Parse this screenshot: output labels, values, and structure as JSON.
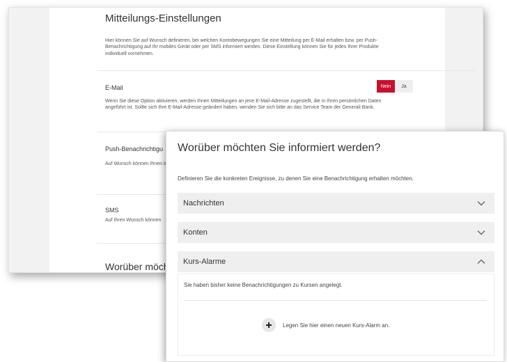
{
  "back": {
    "title": "Mitteilungs-Einstellungen",
    "intro": "Hier können Sie auf Wunsch definieren, bei welchen Kontobewegungen Sie eine Mitteilung per E-Mail erhalten bzw. per Push-Benachrichtigung auf Ihr mobiles Gerät oder per SMS informiert werden. Diese Einstellung können Sie für jedes Ihrer Produkte individuell vornehmen.",
    "email_label": "E-Mail",
    "toggle_no": "Nein",
    "toggle_yes": "Ja",
    "email_desc": "Wenn Sie diese Option aktivieren, werden Ihnen Mitteilungen an jene E-Mail-Adresse zugestellt, die in Ihren persönlichen Daten angeführt ist. Sollte sich Ihre E-Mail-Adresse geändert haben, wenden Sie sich bitte an das Service Team der Generali Bank.",
    "push_label": "Push-Benachrichtigu",
    "push_desc": "Auf Wunsch können Ihnen Informationen werden. Stellen Sie sicher, dass Sie App zulässt.",
    "sms_label": "SMS",
    "sms_desc": "Auf Ihren Wunsch können",
    "bottom_heading": "Worüber möchte"
  },
  "front": {
    "title": "Worüber möchten Sie informiert werden?",
    "subtitle": "Definieren Sie die konkreten Ereignisse, zu denen Sie eine Benachrichtigung erhalten möchten.",
    "sections": [
      {
        "label": "Nachrichten",
        "expanded": false
      },
      {
        "label": "Konten",
        "expanded": false
      },
      {
        "label": "Kurs-Alarme",
        "expanded": true
      }
    ],
    "kurs_empty": "Sie haben bisher keine Benachrichtigungen zu Kursen angelegt.",
    "kurs_add": "Legen Sie hier einen neuen Kurs-Alarm an."
  },
  "colors": {
    "accent": "#c8102e",
    "panel": "#efefef"
  },
  "icons": {
    "collapsed": "chevron-down-icon",
    "expanded": "chevron-up-icon",
    "add": "plus-icon"
  }
}
